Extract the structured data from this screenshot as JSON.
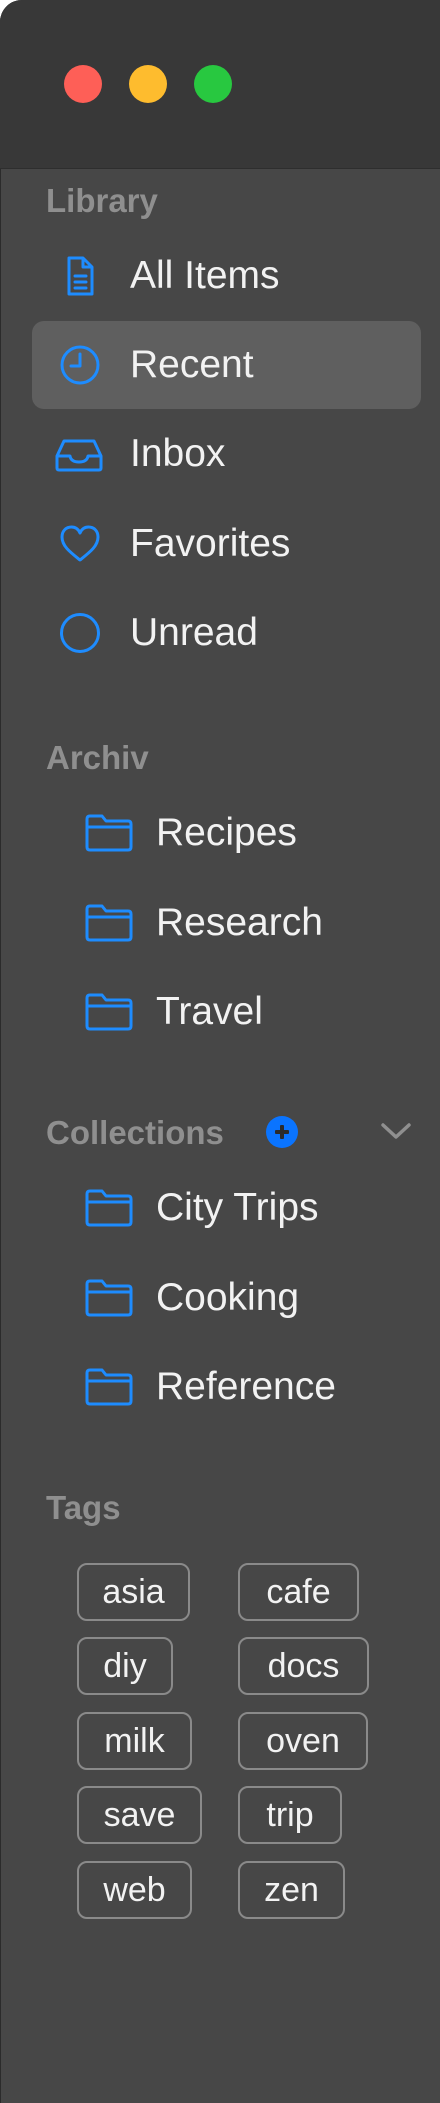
{
  "window": {
    "traffic_lights": [
      "close",
      "minimize",
      "zoom"
    ]
  },
  "library": {
    "title": "Library",
    "items": [
      {
        "label": "All Items",
        "icon": "document-icon",
        "selected": false
      },
      {
        "label": "Recent",
        "icon": "clock-icon",
        "selected": true
      },
      {
        "label": "Inbox",
        "icon": "tray-icon",
        "selected": false
      },
      {
        "label": "Favorites",
        "icon": "heart-icon",
        "selected": false
      },
      {
        "label": "Unread",
        "icon": "circle-icon",
        "selected": false
      }
    ]
  },
  "archive": {
    "title": "Archiv",
    "items": [
      {
        "label": "Recipes",
        "icon": "folder-icon"
      },
      {
        "label": "Research",
        "icon": "folder-icon"
      },
      {
        "label": "Travel",
        "icon": "folder-icon"
      }
    ]
  },
  "collections": {
    "title": "Collections",
    "items": [
      {
        "label": "City Trips",
        "icon": "folder-icon"
      },
      {
        "label": "Cooking",
        "icon": "folder-icon"
      },
      {
        "label": "Reference",
        "icon": "folder-icon"
      }
    ]
  },
  "tags": {
    "title": "Tags",
    "items": [
      "asia",
      "cafe",
      "diy",
      "docs",
      "milk",
      "oven",
      "save",
      "trip",
      "web",
      "zen"
    ]
  },
  "colors": {
    "accent": "#1e8cff",
    "sidebar_bg": "#474747",
    "titlebar_bg": "#383838",
    "selected_bg": "#5f5f5f",
    "section_title": "#8f8f8f",
    "text": "#f2f2f2",
    "add_button": "#0a74ff"
  }
}
